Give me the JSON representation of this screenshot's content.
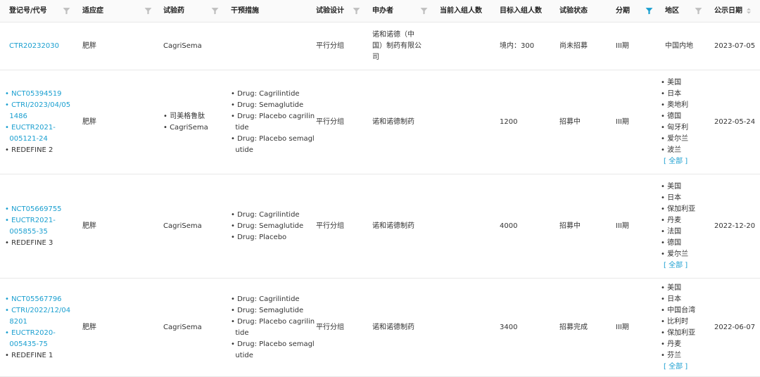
{
  "colors": {
    "link": "#1a9fd0",
    "filter_inactive": "#bfbfbf",
    "filter_active": "#1a9fd0"
  },
  "header": {
    "columns": [
      {
        "label": "登记号/代号",
        "filter": true
      },
      {
        "label": "适应症",
        "filter": true
      },
      {
        "label": "试验药",
        "filter": true
      },
      {
        "label": "干预措施",
        "filter": false
      },
      {
        "label": "试验设计",
        "filter": true
      },
      {
        "label": "申办者",
        "filter": true
      },
      {
        "label": "当前入组人数",
        "filter": false
      },
      {
        "label": "目标入组人数",
        "filter": false
      },
      {
        "label": "试验状态",
        "filter": false
      },
      {
        "label": "分期",
        "filter": true,
        "filter_active": true
      },
      {
        "label": "地区",
        "filter": true
      },
      {
        "label": "公示日期",
        "sorter": true
      }
    ]
  },
  "rows": [
    {
      "ids": [
        "CTR20232030"
      ],
      "indication": "肥胖",
      "drug": [
        "CagriSema"
      ],
      "interventions": [],
      "design": "平行分组",
      "sponsor": [
        "诺和诺德（中",
        "国）制药有限公",
        "司"
      ],
      "current_enroll": "",
      "target_enroll": "境内：300",
      "status": "尚未招募",
      "phase": "III期",
      "regions": [
        "中国内地"
      ],
      "date": "2023-07-05"
    },
    {
      "ids": [
        "NCT05394519",
        "CTRI/2023/04/05",
        "1486",
        "EUCTR2021-",
        "005121-24"
      ],
      "code": "REDEFINE 2",
      "indication": "肥胖",
      "drug": [
        "司美格鲁肽",
        "CagriSema"
      ],
      "interventions": [
        "Drug: Cagrilintide",
        "Drug: Semaglutide",
        "Drug: Placebo cagrilin",
        "tide",
        "Drug: Placebo semagl",
        "utide"
      ],
      "design": "平行分组",
      "sponsor": [
        "诺和诺德制药"
      ],
      "current_enroll": "",
      "target_enroll": "1200",
      "status": "招募中",
      "phase": "III期",
      "regions": [
        "美国",
        "日本",
        "奥地利",
        "德国",
        "匈牙利",
        "爱尔兰",
        "波兰"
      ],
      "more": "[ 全部 ]",
      "date": "2022-05-24"
    },
    {
      "ids": [
        "NCT05669755",
        "EUCTR2021-",
        "005855-35"
      ],
      "code": "REDEFINE 3",
      "indication": "肥胖",
      "drug": [
        "CagriSema"
      ],
      "interventions": [
        "Drug: Cagrilintide",
        "Drug: Semaglutide",
        "Drug: Placebo"
      ],
      "design": "平行分组",
      "sponsor": [
        "诺和诺德制药"
      ],
      "current_enroll": "",
      "target_enroll": "4000",
      "status": "招募中",
      "phase": "III期",
      "regions": [
        "美国",
        "日本",
        "保加利亚",
        "丹麦",
        "法国",
        "德国",
        "爱尔兰"
      ],
      "more": "[ 全部 ]",
      "date": "2022-12-20"
    },
    {
      "ids": [
        "NCT05567796",
        "CTRI/2022/12/04",
        "8201",
        "EUCTR2020-",
        "005435-75"
      ],
      "code": "REDEFINE 1",
      "indication": "肥胖",
      "drug": [
        "CagriSema"
      ],
      "interventions": [
        "Drug: Cagrilintide",
        "Drug: Semaglutide",
        "Drug: Placebo cagrilin",
        "tide",
        "Drug: Placebo semagl",
        "utide"
      ],
      "design": "平行分组",
      "sponsor": [
        "诺和诺德制药"
      ],
      "current_enroll": "",
      "target_enroll": "3400",
      "status": "招募完成",
      "phase": "III期",
      "regions": [
        "美国",
        "日本",
        "中国台湾",
        "比利时",
        "保加利亚",
        "丹麦",
        "芬兰"
      ],
      "more": "[ 全部 ]",
      "date": "2022-06-07"
    }
  ]
}
